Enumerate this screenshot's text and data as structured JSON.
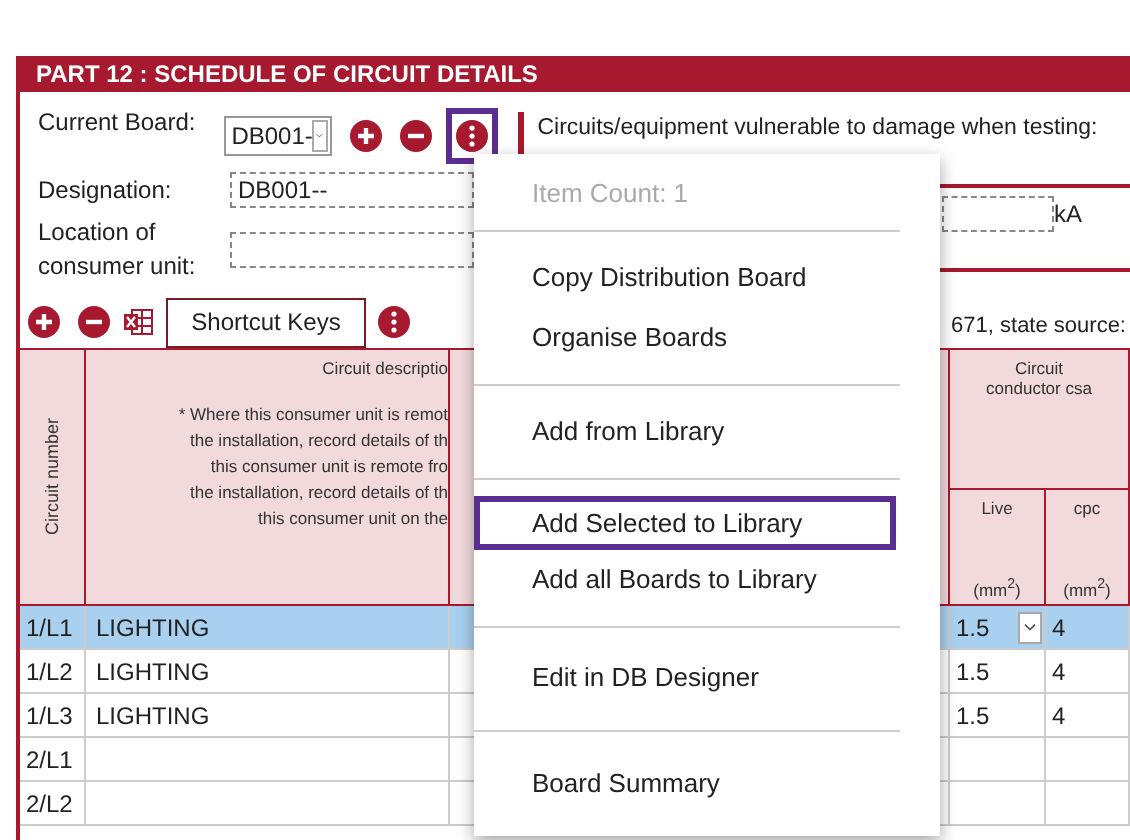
{
  "section_title": "PART 12 : SCHEDULE OF CIRCUIT DETAILS",
  "board": {
    "label": "Current Board:",
    "value": "DB001-",
    "menu_button_highlighted": true
  },
  "vulnerable_label": "Circuits/equipment vulnerable to damage when testing:",
  "designation": {
    "label": "Designation:",
    "value": "DB001--"
  },
  "location": {
    "label": "Location of consumer unit:"
  },
  "fault_unit": "kA",
  "source_text": "671, state source:",
  "shortcut_button": "Shortcut Keys",
  "table": {
    "number_header": "Circuit number",
    "description_header": "Circuit descriptio",
    "description_note": [
      "* Where this consumer unit is remot",
      "the installation, record details of th",
      "this consumer unit is remote fro",
      "the installation, record details of th",
      "this consumer unit on the"
    ],
    "csa_header": "Circuit conductor csa",
    "live_header": "Live",
    "cpc_header": "cpc",
    "live_unit": "(mm$^{2}$)",
    "cpc_unit": "(mm$^{2}$)",
    "rows": [
      {
        "number": "1/L1",
        "description": "LIGHTING",
        "live": "1.5",
        "cpc": "4",
        "selected": true
      },
      {
        "number": "1/L2",
        "description": "LIGHTING",
        "live": "1.5",
        "cpc": "4",
        "selected": false
      },
      {
        "number": "1/L3",
        "description": "LIGHTING",
        "live": "1.5",
        "cpc": "4",
        "selected": false
      },
      {
        "number": "2/L1",
        "description": "",
        "live": "",
        "cpc": "",
        "selected": false
      },
      {
        "number": "2/L2",
        "description": "",
        "live": "",
        "cpc": "",
        "selected": false
      }
    ]
  },
  "menu": {
    "item_count": "Item Count: 1",
    "groups": [
      [
        {
          "label": "Copy Distribution Board",
          "selected": false
        },
        {
          "label": "Organise Boards",
          "selected": false
        }
      ],
      [
        {
          "label": "Add from Library",
          "selected": false
        }
      ],
      [
        {
          "label": "Add Selected to Library",
          "selected": true
        },
        {
          "label": "Add all Boards to Library",
          "selected": false
        }
      ],
      [
        {
          "label": "Edit in DB Designer",
          "selected": false
        }
      ],
      [
        {
          "label": "Board Summary",
          "selected": false
        }
      ]
    ]
  }
}
